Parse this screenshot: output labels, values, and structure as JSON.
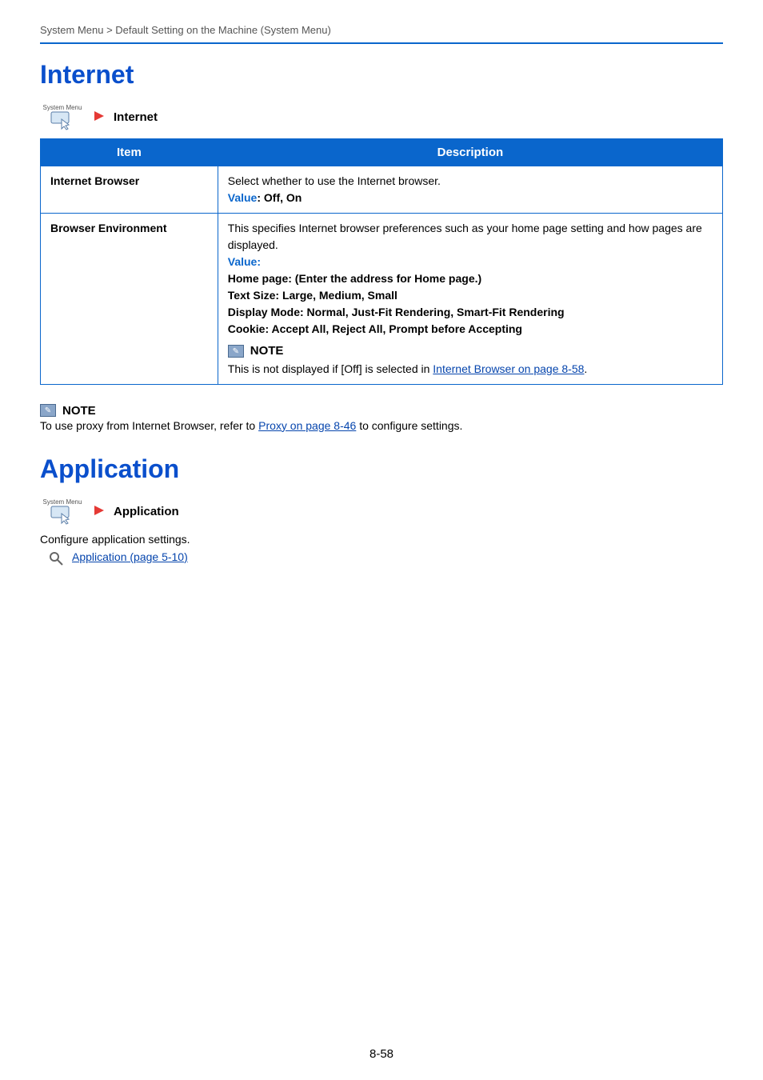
{
  "header": {
    "running": "System Menu > Default Setting on the Machine (System Menu)"
  },
  "internet": {
    "title": "Internet",
    "breadcrumb": {
      "smLabel": "System Menu",
      "crumb": "Internet"
    },
    "table": {
      "headers": {
        "item": "Item",
        "desc": "Description"
      },
      "rows": [
        {
          "item": "Internet Browser",
          "desc_line1": "Select whether to use the Internet browser.",
          "value_label": "Value",
          "value_text": ": Off, On"
        },
        {
          "item": "Browser Environment",
          "desc_line1": "This specifies Internet browser preferences such as your home page setting and how pages are displayed.",
          "value_label": "Value",
          "value_colon": ":",
          "b1": "Home page: (Enter the address for Home page.)",
          "b2": "Text Size: Large, Medium, Small",
          "b3": "Display Mode: Normal, Just-Fit Rendering, Smart-Fit Rendering",
          "b4": "Cookie: Accept All, Reject All, Prompt before Accepting",
          "note_label": "NOTE",
          "note_pre": "This is not displayed if [Off] is selected in ",
          "note_link": "Internet Browser on page 8-58",
          "note_post": "."
        }
      ]
    },
    "outer_note": {
      "label": "NOTE",
      "pre": "To use proxy from Internet Browser, refer to ",
      "link": "Proxy on page 8-46",
      "post": " to configure settings."
    }
  },
  "application": {
    "title": "Application",
    "breadcrumb": {
      "smLabel": "System Menu",
      "crumb": "Application"
    },
    "desc": "Configure application settings.",
    "ref_link": "Application (page 5-10)"
  },
  "footer": {
    "page": "8-58"
  }
}
